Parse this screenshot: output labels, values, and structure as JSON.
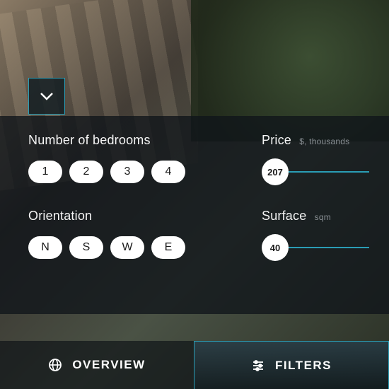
{
  "filters": {
    "bedrooms": {
      "label": "Number of bedrooms",
      "options": [
        "1",
        "2",
        "3",
        "4"
      ]
    },
    "orientation": {
      "label": "Orientation",
      "options": [
        "N",
        "S",
        "W",
        "E"
      ]
    },
    "price": {
      "label": "Price",
      "unit": "$, thousands",
      "value": "207"
    },
    "surface": {
      "label": "Surface",
      "unit": "sqm",
      "value": "40"
    }
  },
  "tabs": {
    "overview": "OVERVIEW",
    "filters": "FILTERS"
  }
}
